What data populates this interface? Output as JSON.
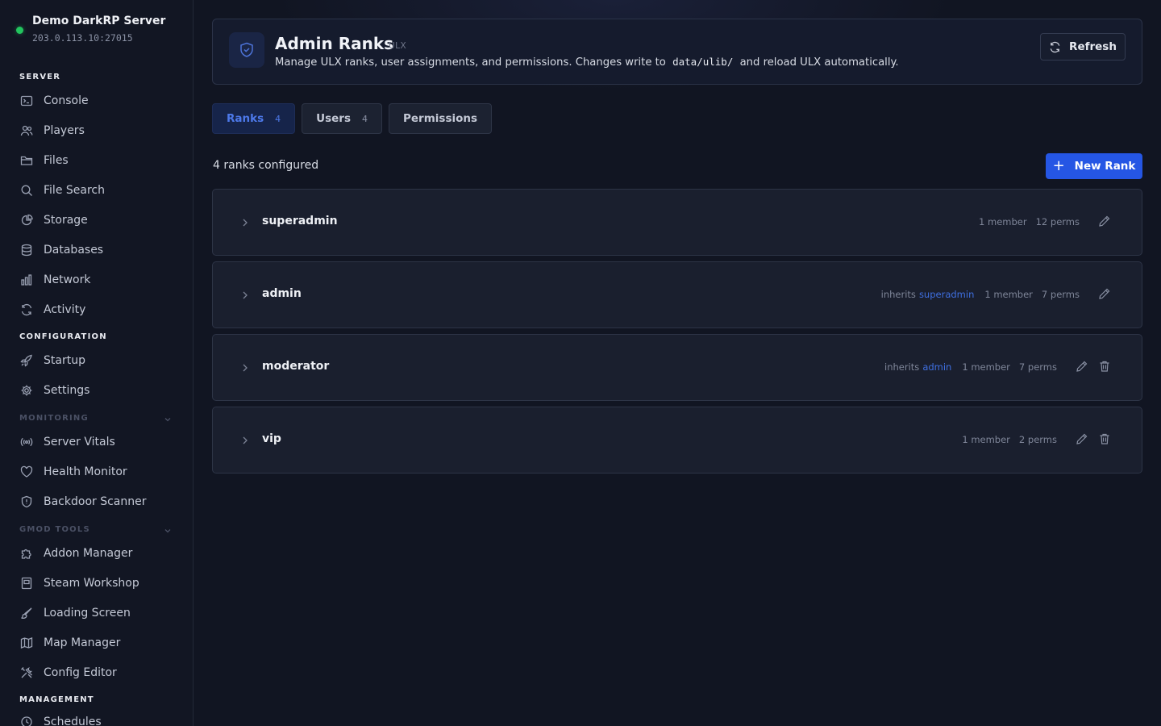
{
  "server": {
    "name": "Demo DarkRP Server",
    "address": "203.0.113.10:27015",
    "status_color": "#22c55e"
  },
  "sidebar": {
    "sections": [
      {
        "label": "SERVER"
      },
      {
        "label": "CONFIGURATION"
      },
      {
        "label": "MONITORING"
      },
      {
        "label": "GMOD TOOLS"
      },
      {
        "label": "MANAGEMENT"
      }
    ],
    "items": [
      {
        "label": "Console",
        "icon": "terminal-icon"
      },
      {
        "label": "Players",
        "icon": "users-icon"
      },
      {
        "label": "Files",
        "icon": "folder-icon"
      },
      {
        "label": "File Search",
        "icon": "search-icon"
      },
      {
        "label": "Storage",
        "icon": "pie-chart-icon"
      },
      {
        "label": "Databases",
        "icon": "database-icon"
      },
      {
        "label": "Network",
        "icon": "bar-chart-icon"
      },
      {
        "label": "Activity",
        "icon": "refresh-icon"
      },
      {
        "label": "Startup",
        "icon": "rocket-icon"
      },
      {
        "label": "Settings",
        "icon": "gear-icon"
      },
      {
        "label": "Server Vitals",
        "icon": "broadcast-icon"
      },
      {
        "label": "Health Monitor",
        "icon": "heart-icon"
      },
      {
        "label": "Backdoor Scanner",
        "icon": "shield-icon"
      },
      {
        "label": "Addon Manager",
        "icon": "puzzle-icon"
      },
      {
        "label": "Steam Workshop",
        "icon": "book-icon"
      },
      {
        "label": "Loading Screen",
        "icon": "brush-icon"
      },
      {
        "label": "Map Manager",
        "icon": "map-icon"
      },
      {
        "label": "Config Editor",
        "icon": "tools-icon"
      },
      {
        "label": "Schedules",
        "icon": "clock-icon"
      }
    ]
  },
  "header": {
    "title": "Admin Ranks",
    "tag": "ULX",
    "desc_before": "Manage ULX ranks, user assignments, and permissions. Changes write to",
    "desc_code": "data/ulib/",
    "desc_after": "and reload ULX automatically.",
    "refresh_label": "Refresh"
  },
  "tabs": [
    {
      "label": "Ranks",
      "count": "4",
      "active": true
    },
    {
      "label": "Users",
      "count": "4"
    },
    {
      "label": "Permissions"
    }
  ],
  "ranks_summary": "4 ranks configured",
  "new_rank_label": "New Rank",
  "inherits_label": "inherits",
  "accent_color": "#2556e4",
  "ranks": [
    {
      "name": "superadmin",
      "inherits": "",
      "members": "1 member",
      "perms": "12 perms",
      "deletable": false
    },
    {
      "name": "admin",
      "inherits": "superadmin",
      "members": "1 member",
      "perms": "7 perms",
      "deletable": false
    },
    {
      "name": "moderator",
      "inherits": "admin",
      "members": "1 member",
      "perms": "7 perms",
      "deletable": true
    },
    {
      "name": "vip",
      "inherits": "",
      "members": "1 member",
      "perms": "2 perms",
      "deletable": true
    }
  ]
}
